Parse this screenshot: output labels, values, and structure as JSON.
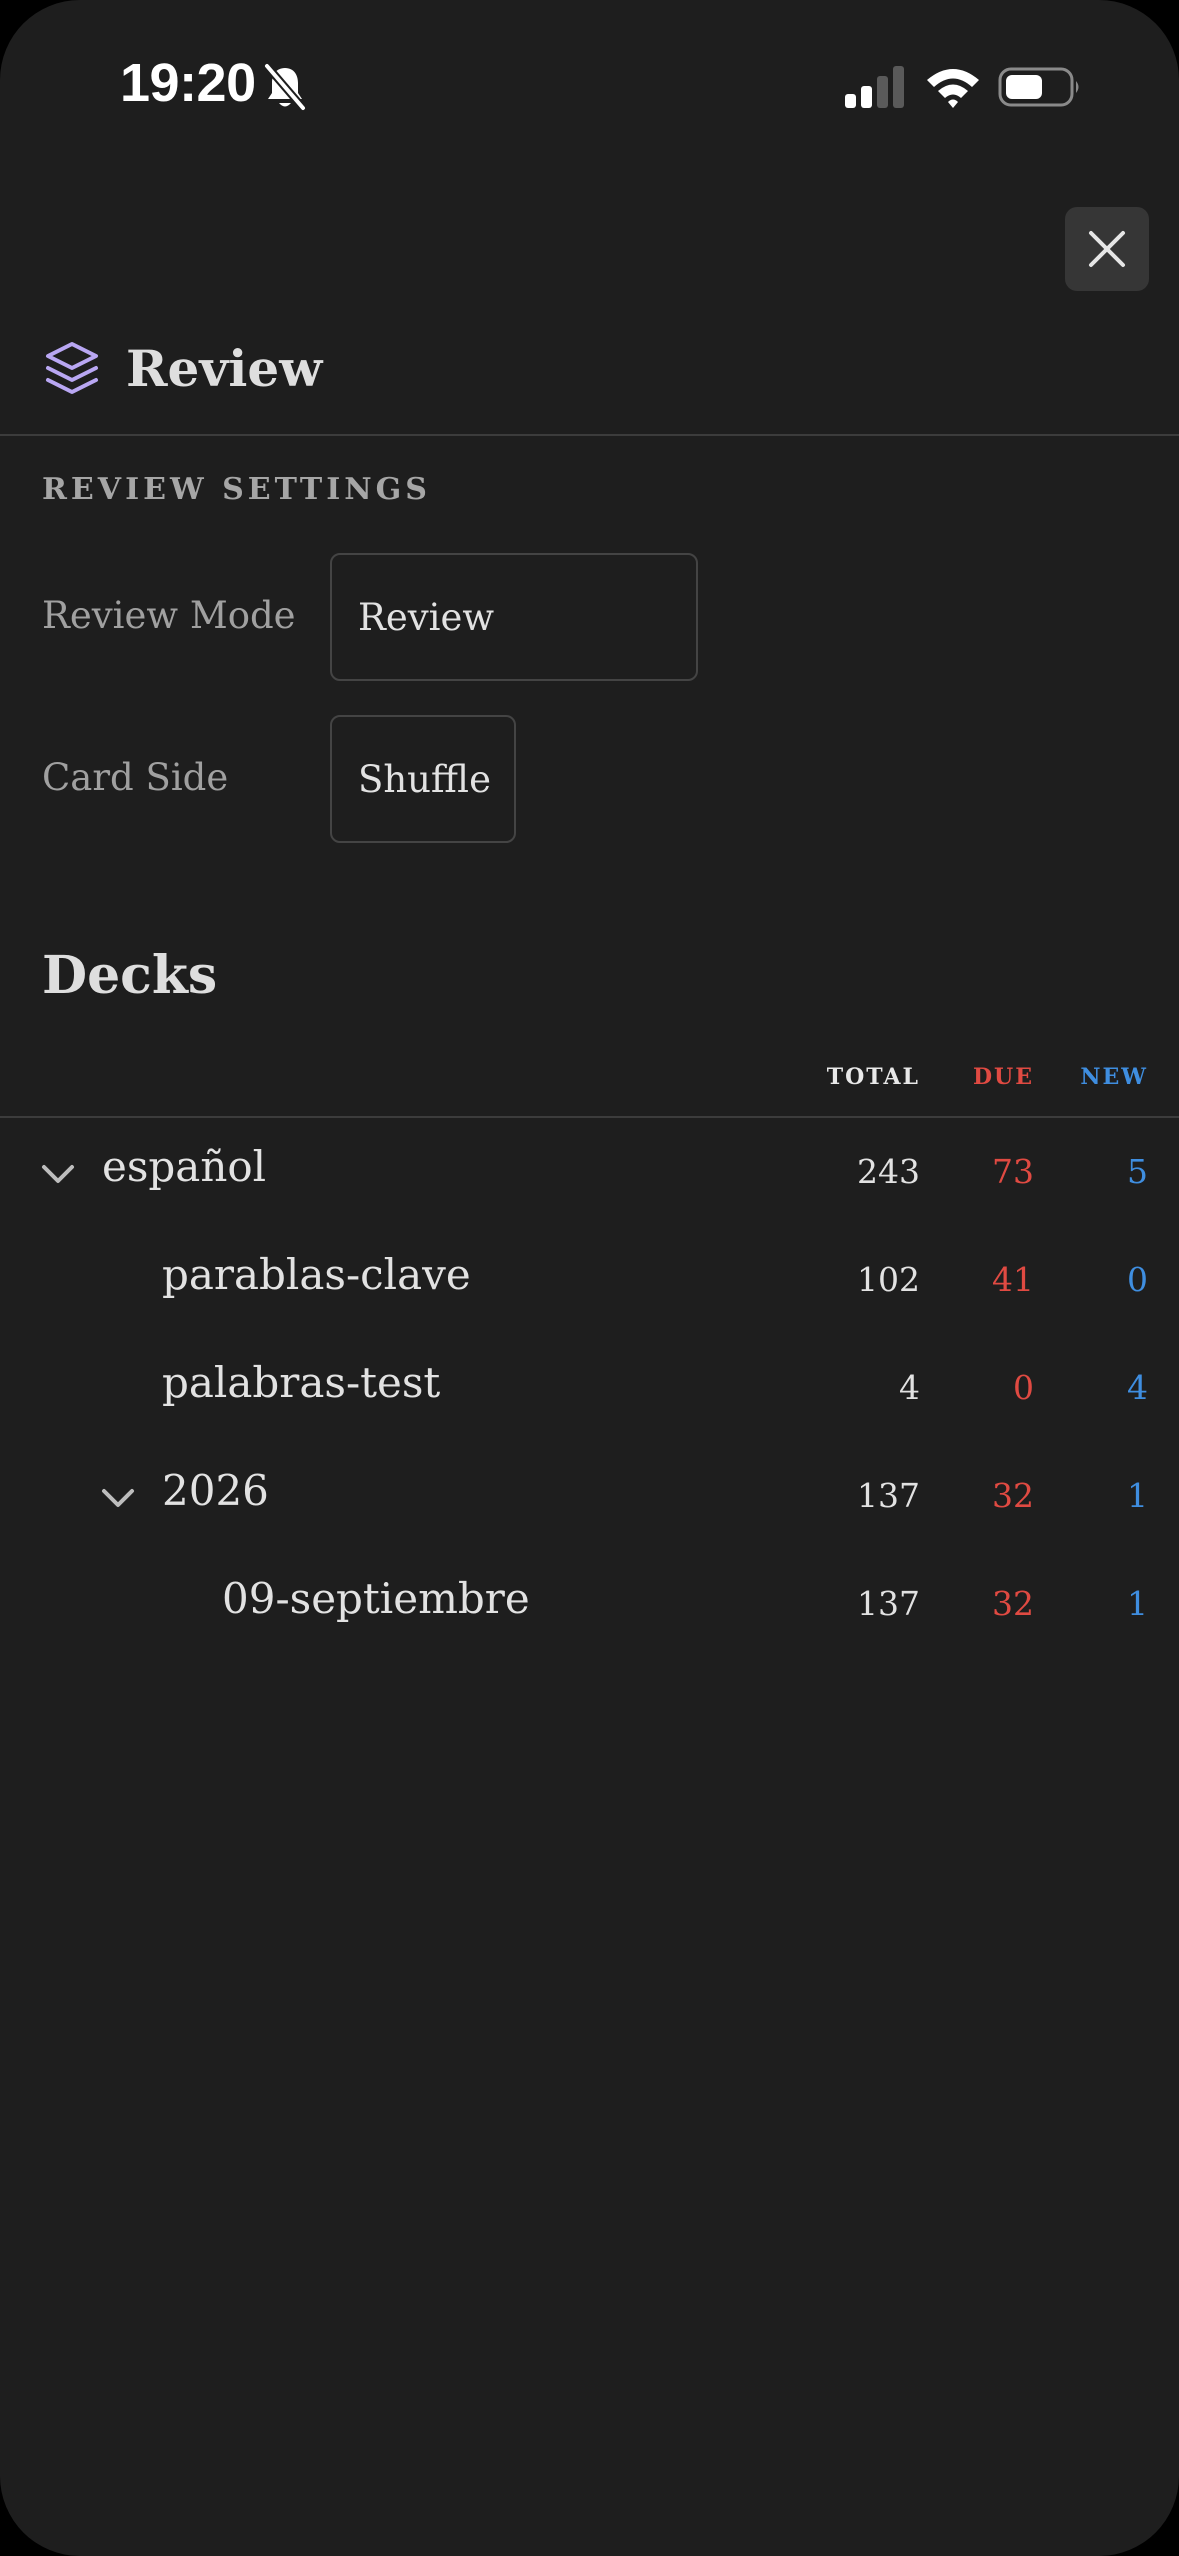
{
  "status_bar": {
    "time": "19:20",
    "icons": [
      "bell-slash-icon",
      "cellular-signal-icon",
      "wifi-icon",
      "battery-icon"
    ]
  },
  "header": {
    "icon": "layers-icon",
    "title": "Review",
    "close_icon": "close-icon"
  },
  "settings": {
    "section_label": "REVIEW SETTINGS",
    "review_mode": {
      "label": "Review Mode",
      "value": "Review"
    },
    "card_side": {
      "label": "Card Side",
      "value": "Shuffle"
    }
  },
  "decks": {
    "title": "Decks",
    "columns": {
      "total": "TOTAL",
      "due": "DUE",
      "new": "NEW"
    },
    "rows": [
      {
        "name": "español",
        "total": "243",
        "due": "73",
        "new": "5",
        "level": 0,
        "expanded": true
      },
      {
        "name": "parablas-clave",
        "total": "102",
        "due": "41",
        "new": "0",
        "level": 1,
        "expanded": null
      },
      {
        "name": "palabras-test",
        "total": "4",
        "due": "0",
        "new": "4",
        "level": 1,
        "expanded": null
      },
      {
        "name": "2026",
        "total": "137",
        "due": "32",
        "new": "1",
        "level": 1,
        "expanded": true
      },
      {
        "name": "09-septiembre",
        "total": "137",
        "due": "32",
        "new": "1",
        "level": 2,
        "expanded": null
      }
    ]
  },
  "colors": {
    "background": "#1e1e1e",
    "accent_icon": "#b9a7f3",
    "due": "#e04a42",
    "new": "#3f8ee0",
    "total": "#e2e2e2"
  }
}
